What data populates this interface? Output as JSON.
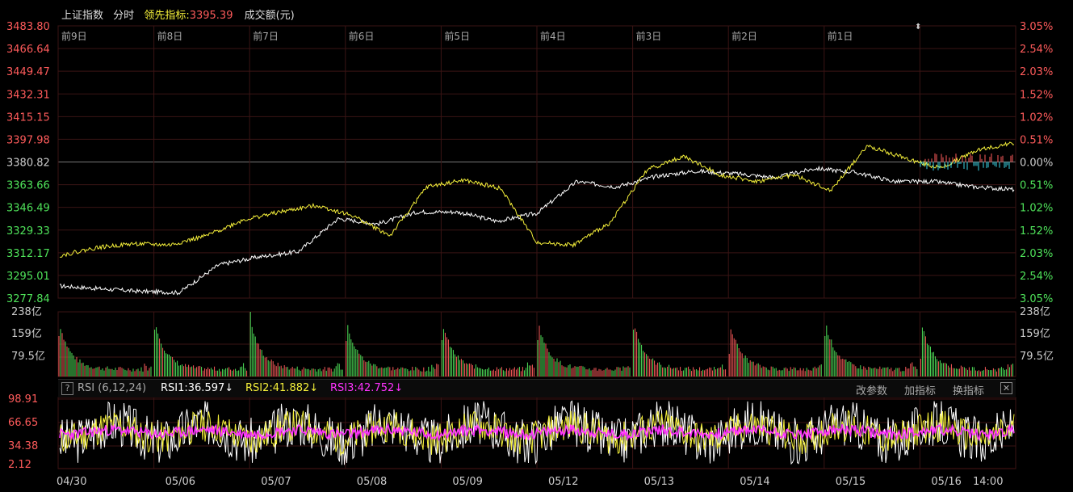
{
  "header": {
    "index_name": "上证指数",
    "mode": "分时",
    "leading_label": "领先指标:",
    "leading_value": "3395.39",
    "volume_label": "成交额(元)"
  },
  "colors": {
    "up": "#ff5b5b",
    "down": "#4fe35a",
    "price_line": "#ffffff",
    "leading_line": "#f5f03a",
    "rsi1": "#ffffff",
    "rsi2": "#f5f03a",
    "rsi3": "#ff33ff",
    "grid": "#3a1414"
  },
  "price_axis": {
    "left_ticks": [
      "3483.80",
      "3466.64",
      "3449.47",
      "3432.31",
      "3415.15",
      "3397.98",
      "3380.82",
      "3363.66",
      "3346.49",
      "3329.33",
      "3312.17",
      "3295.01",
      "3277.84"
    ],
    "right_ticks": [
      "3.05%",
      "2.54%",
      "2.03%",
      "1.52%",
      "1.02%",
      "0.51%",
      "0.00%",
      "0.51%",
      "1.02%",
      "1.52%",
      "2.03%",
      "2.54%",
      "3.05%"
    ],
    "min": 3277.84,
    "max": 3483.8
  },
  "day_labels": [
    "前9日",
    "前8日",
    "前7日",
    "前6日",
    "前5日",
    "前4日",
    "前3日",
    "前2日",
    "前1日"
  ],
  "volume_axis": {
    "ticks": [
      "238亿",
      "159亿",
      "79.5亿"
    ]
  },
  "rsi": {
    "title": "RSI (6,12,24)",
    "rsi1": "RSI1:36.597↓",
    "rsi2": "RSI2:41.882↓",
    "rsi3": "RSI3:42.752↓",
    "buttons": [
      "改参数",
      "加指标",
      "换指标"
    ],
    "help": "?",
    "close": "✕",
    "ticks": [
      "98.91",
      "66.65",
      "34.38",
      "2.12"
    ]
  },
  "date_labels": [
    "04/30",
    "05/06",
    "05/07",
    "05/08",
    "05/09",
    "05/12",
    "05/13",
    "05/14",
    "05/15",
    "05/16",
    "14:00"
  ],
  "chart_data": {
    "type": "line",
    "series": [
      {
        "name": "上证指数",
        "color": "#ffffff",
        "values": [
          3287,
          3285,
          3283,
          3282,
          3303,
          3309,
          3313,
          3338,
          3334,
          3343,
          3343,
          3336,
          3342,
          3366,
          3362,
          3370,
          3374,
          3372,
          3369,
          3376,
          3373,
          3366,
          3366,
          3362,
          3360
        ]
      },
      {
        "name": "领先指标",
        "color": "#f5f03a",
        "values": [
          3310,
          3316,
          3319,
          3318,
          3325,
          3337,
          3343,
          3348,
          3340,
          3325,
          3362,
          3367,
          3361,
          3320,
          3318,
          3335,
          3375,
          3385,
          3371,
          3366,
          3371,
          3359,
          3393,
          3384,
          3376,
          3390,
          3395
        ]
      }
    ],
    "ylim": [
      3277.84,
      3483.8
    ]
  }
}
